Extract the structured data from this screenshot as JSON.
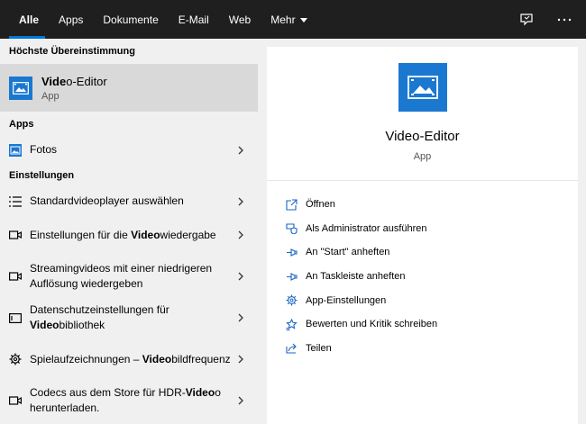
{
  "topbar": {
    "tabs": [
      "Alle",
      "Apps",
      "Dokumente",
      "E-Mail",
      "Web",
      "Mehr"
    ],
    "accent": "#0078d7"
  },
  "left": {
    "best_match_header": "Höchste Übereinstimmung",
    "best_match": {
      "name_bold": "Vide",
      "name_rest": "o-Editor",
      "sub": "App",
      "icon": "video-editor-icon"
    },
    "apps_header": "Apps",
    "apps": [
      {
        "label": "Fotos",
        "icon": "photos-icon"
      }
    ],
    "settings_header": "Einstellungen",
    "settings": [
      {
        "parts": [
          {
            "t": "Standardvideoplayer auswählen",
            "b": false
          }
        ],
        "icon": "list-icon"
      },
      {
        "parts": [
          {
            "t": "Einstellungen für die ",
            "b": false
          },
          {
            "t": "Video",
            "b": true
          },
          {
            "t": "wiedergabe",
            "b": false
          }
        ],
        "icon": "video-camera-icon"
      },
      {
        "parts": [
          {
            "t": "Streamingvideos mit einer niedrigeren Auflösung wiedergeben",
            "b": false
          }
        ],
        "icon": "video-camera-icon"
      },
      {
        "parts": [
          {
            "t": "Datenschutzeinstellungen für ",
            "b": false
          },
          {
            "t": "Video",
            "b": true
          },
          {
            "t": "bibliothek",
            "b": false
          }
        ],
        "icon": "screen-icon"
      },
      {
        "parts": [
          {
            "t": "Spielaufzeichnungen – ",
            "b": false
          },
          {
            "t": "Video",
            "b": true
          },
          {
            "t": "bildfrequenz",
            "b": false
          }
        ],
        "icon": "gear-icon"
      },
      {
        "parts": [
          {
            "t": "Codecs aus dem Store für HDR-",
            "b": false
          },
          {
            "t": "Video",
            "b": true
          },
          {
            "t": "o herunterladen.",
            "b": false
          }
        ],
        "icon": "video-camera-icon"
      }
    ]
  },
  "detail": {
    "title": "Video-Editor",
    "sub": "App",
    "actions": [
      {
        "label": "Öffnen",
        "icon": "open-icon"
      },
      {
        "label": "Als Administrator ausführen",
        "icon": "shield-icon"
      },
      {
        "label": "An \"Start\" anheften",
        "icon": "pin-icon"
      },
      {
        "label": "An Taskleiste anheften",
        "icon": "pin-icon"
      },
      {
        "label": "App-Einstellungen",
        "icon": "gear-icon"
      },
      {
        "label": "Bewerten und Kritik schreiben",
        "icon": "star-icon"
      },
      {
        "label": "Teilen",
        "icon": "share-icon"
      }
    ]
  }
}
